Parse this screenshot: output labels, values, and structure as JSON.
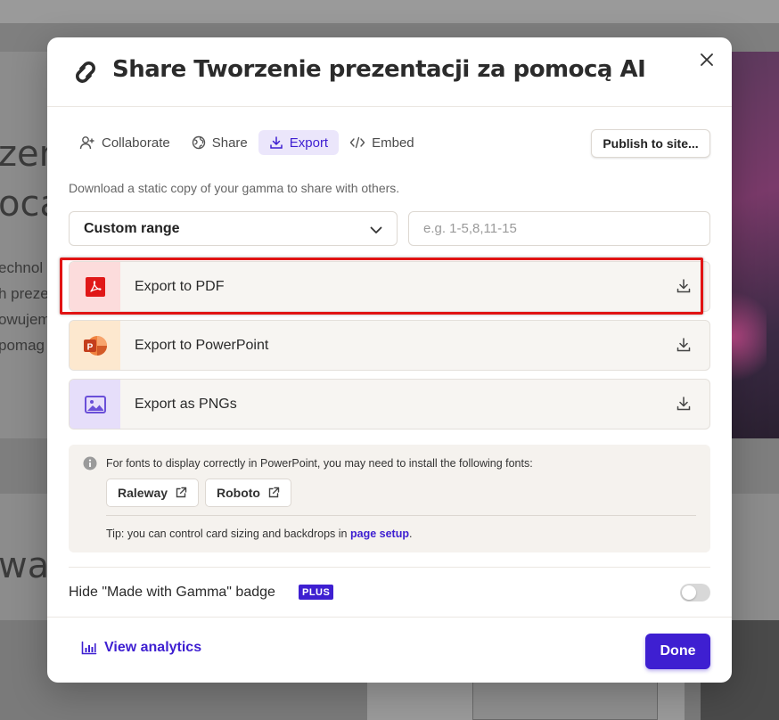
{
  "background": {
    "heading_line1": "zen",
    "heading_line2": "ocą",
    "text_lines": [
      "echnol",
      "h preze",
      "owujem",
      "pomag"
    ],
    "section_heading": "wa"
  },
  "modal": {
    "title": "Share Tworzenie prezentacji za pomocą AI",
    "tabs": [
      {
        "label": "Collaborate",
        "icon": "user-plus-icon",
        "active": false
      },
      {
        "label": "Share",
        "icon": "globe-icon",
        "active": false
      },
      {
        "label": "Export",
        "icon": "download-icon",
        "active": true
      },
      {
        "label": "Embed",
        "icon": "code-icon",
        "active": false
      }
    ],
    "publish_label": "Publish to site...",
    "description": "Download a static copy of your gamma to share with others.",
    "range": {
      "selected": "Custom range",
      "placeholder": "e.g. 1-5,8,11-15"
    },
    "exports": [
      {
        "label": "Export to PDF",
        "icon": "pdf-icon"
      },
      {
        "label": "Export to PowerPoint",
        "icon": "powerpoint-icon"
      },
      {
        "label": "Export as PNGs",
        "icon": "image-icon"
      }
    ],
    "fonts_note": "For fonts to display correctly in PowerPoint, you may need to install the following fonts:",
    "fonts": [
      "Raleway",
      "Roboto"
    ],
    "tip_prefix": "Tip: you can control card sizing and backdrops in ",
    "tip_link": "page setup",
    "tip_suffix": ".",
    "badge_label": "Hide \"Made with Gamma\" badge",
    "plus_label": "PLUS",
    "badge_toggle_on": false,
    "view_analytics_label": "View analytics",
    "done_label": "Done"
  },
  "colors": {
    "accent": "#3e1fd1",
    "pdf_bg": "#fcdcdc",
    "ppt_bg": "#fde8cf",
    "png_bg": "#e6defa",
    "highlight": "#e11414"
  }
}
